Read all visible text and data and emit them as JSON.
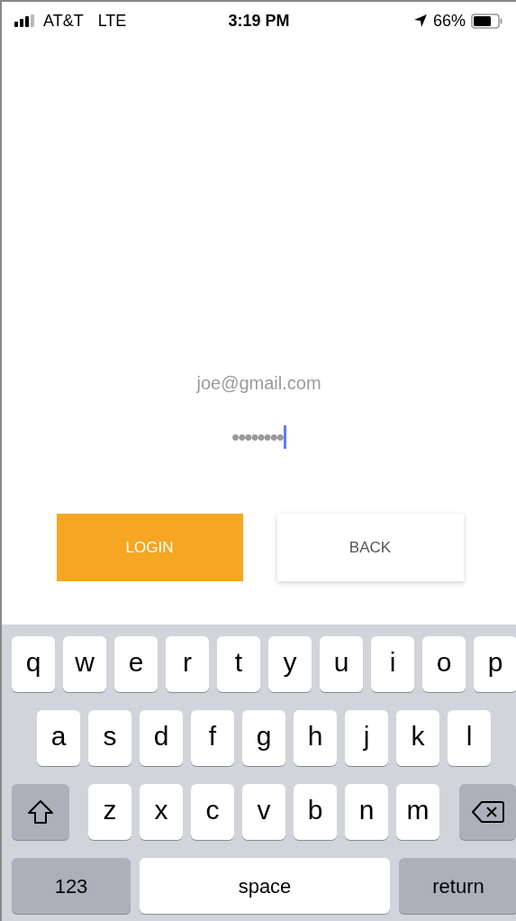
{
  "status_bar": {
    "carrier": "AT&T",
    "network": "LTE",
    "time": "3:19 PM",
    "battery": "66%"
  },
  "form": {
    "email": {
      "value": "joe@gmail.com"
    },
    "password": {
      "value": "••••••••",
      "focused": true
    }
  },
  "buttons": [
    {
      "label": "LOGIN",
      "kind": "primary"
    },
    {
      "label": "BACK",
      "kind": "secondary"
    }
  ],
  "keyboard": {
    "rows": [
      [
        {
          "kind": "char",
          "label": "q"
        },
        {
          "kind": "char",
          "label": "w"
        },
        {
          "kind": "char",
          "label": "e"
        },
        {
          "kind": "char",
          "label": "r"
        },
        {
          "kind": "char",
          "label": "t"
        },
        {
          "kind": "char",
          "label": "y"
        },
        {
          "kind": "char",
          "label": "u"
        },
        {
          "kind": "char",
          "label": "i"
        },
        {
          "kind": "char",
          "label": "o"
        },
        {
          "kind": "char",
          "label": "p"
        }
      ],
      [
        {
          "kind": "char",
          "label": "a"
        },
        {
          "kind": "char",
          "label": "s"
        },
        {
          "kind": "char",
          "label": "d"
        },
        {
          "kind": "char",
          "label": "f"
        },
        {
          "kind": "char",
          "label": "g"
        },
        {
          "kind": "char",
          "label": "h"
        },
        {
          "kind": "char",
          "label": "j"
        },
        {
          "kind": "char",
          "label": "k"
        },
        {
          "kind": "char",
          "label": "l"
        }
      ],
      [
        {
          "kind": "shift"
        },
        {
          "kind": "char",
          "label": "z"
        },
        {
          "kind": "char",
          "label": "x"
        },
        {
          "kind": "char",
          "label": "c"
        },
        {
          "kind": "char",
          "label": "v"
        },
        {
          "kind": "char",
          "label": "b"
        },
        {
          "kind": "char",
          "label": "n"
        },
        {
          "kind": "char",
          "label": "m"
        },
        {
          "kind": "delete"
        }
      ]
    ],
    "bottom_row": {
      "numbers_key": "123",
      "space_key": "space",
      "return_key": "return"
    }
  }
}
